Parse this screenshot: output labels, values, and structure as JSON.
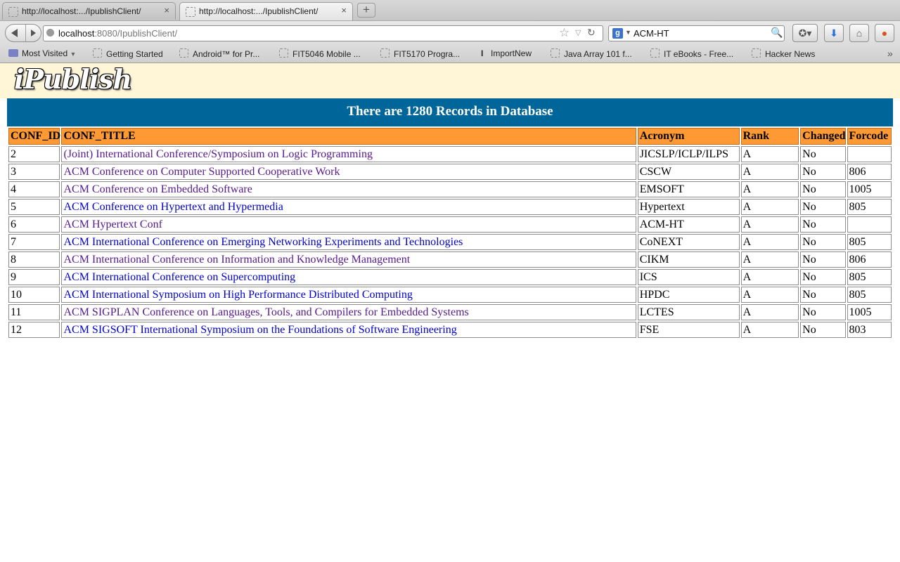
{
  "browser": {
    "tabs": [
      {
        "title": "http://localhost:.../IpublishClient/"
      },
      {
        "title": "http://localhost:.../IpublishClient/"
      }
    ],
    "new_tab_label": "+",
    "url_host": "localhost",
    "url_rest": ":8080/IpublishClient/",
    "search_engine_label": "g",
    "search_value": "ACM-HT",
    "bookmarks": [
      {
        "label": "Most Visited"
      },
      {
        "label": "Getting Started"
      },
      {
        "label": "Android™ for Pr..."
      },
      {
        "label": "FIT5046 Mobile ..."
      },
      {
        "label": "FIT5170 Progra..."
      },
      {
        "label": "ImportNew"
      },
      {
        "label": "Java Array 101 f..."
      },
      {
        "label": "IT eBooks - Free..."
      },
      {
        "label": "Hacker News"
      }
    ],
    "icons": {
      "back": "back-arrow-icon",
      "forward": "forward-arrow-icon",
      "bookmark_star": "star-icon",
      "reload": "reload-icon",
      "search_go": "magnifier-icon",
      "download": "download-arrow-icon",
      "home": "home-icon",
      "firebug": "firebug-icon"
    }
  },
  "page": {
    "logo": "iPublish",
    "records_banner": "There are 1280 Records in Database",
    "colors": {
      "header_bg": "#fff6d8",
      "banner_bg": "#006699",
      "table_header_bg": "#ff9933",
      "visited_link": "#551a8b",
      "unvisited_link": "#0000cc"
    },
    "table": {
      "columns": [
        "CONF_ID",
        "CONF_TITLE",
        "Acronym",
        "Rank",
        "Changed",
        "Forcode"
      ],
      "rows": [
        {
          "id": "2",
          "title": "(Joint) International Conference/Symposium on Logic Programming",
          "acronym": "JICSLP/ICLP/ILPS",
          "rank": "A",
          "changed": "No",
          "forcode": "",
          "visited": true
        },
        {
          "id": "3",
          "title": "ACM Conference on Computer Supported Cooperative Work",
          "acronym": "CSCW",
          "rank": "A",
          "changed": "No",
          "forcode": "806",
          "visited": true
        },
        {
          "id": "4",
          "title": "ACM Conference on Embedded Software",
          "acronym": "EMSOFT",
          "rank": "A",
          "changed": "No",
          "forcode": "1005",
          "visited": true
        },
        {
          "id": "5",
          "title": "ACM Conference on Hypertext and Hypermedia",
          "acronym": "Hypertext",
          "rank": "A",
          "changed": "No",
          "forcode": "805",
          "visited": false
        },
        {
          "id": "6",
          "title": "ACM Hypertext Conf",
          "acronym": "ACM-HT",
          "rank": "A",
          "changed": "No",
          "forcode": "",
          "visited": true
        },
        {
          "id": "7",
          "title": "ACM International Conference on Emerging Networking Experiments and Technologies",
          "acronym": "CoNEXT",
          "rank": "A",
          "changed": "No",
          "forcode": "805",
          "visited": false
        },
        {
          "id": "8",
          "title": "ACM International Conference on Information and Knowledge Management",
          "acronym": "CIKM",
          "rank": "A",
          "changed": "No",
          "forcode": "806",
          "visited": true
        },
        {
          "id": "9",
          "title": "ACM International Conference on Supercomputing",
          "acronym": "ICS",
          "rank": "A",
          "changed": "No",
          "forcode": "805",
          "visited": false
        },
        {
          "id": "10",
          "title": "ACM International Symposium on High Performance Distributed Computing",
          "acronym": "HPDC",
          "rank": "A",
          "changed": "No",
          "forcode": "805",
          "visited": false
        },
        {
          "id": "11",
          "title": "ACM SIGPLAN Conference on Languages, Tools, and Compilers for Embedded Systems",
          "acronym": "LCTES",
          "rank": "A",
          "changed": "No",
          "forcode": "1005",
          "visited": true
        },
        {
          "id": "12",
          "title": "ACM SIGSOFT International Symposium on the Foundations of Software Engineering",
          "acronym": "FSE",
          "rank": "A",
          "changed": "No",
          "forcode": "803",
          "visited": false
        }
      ]
    }
  }
}
